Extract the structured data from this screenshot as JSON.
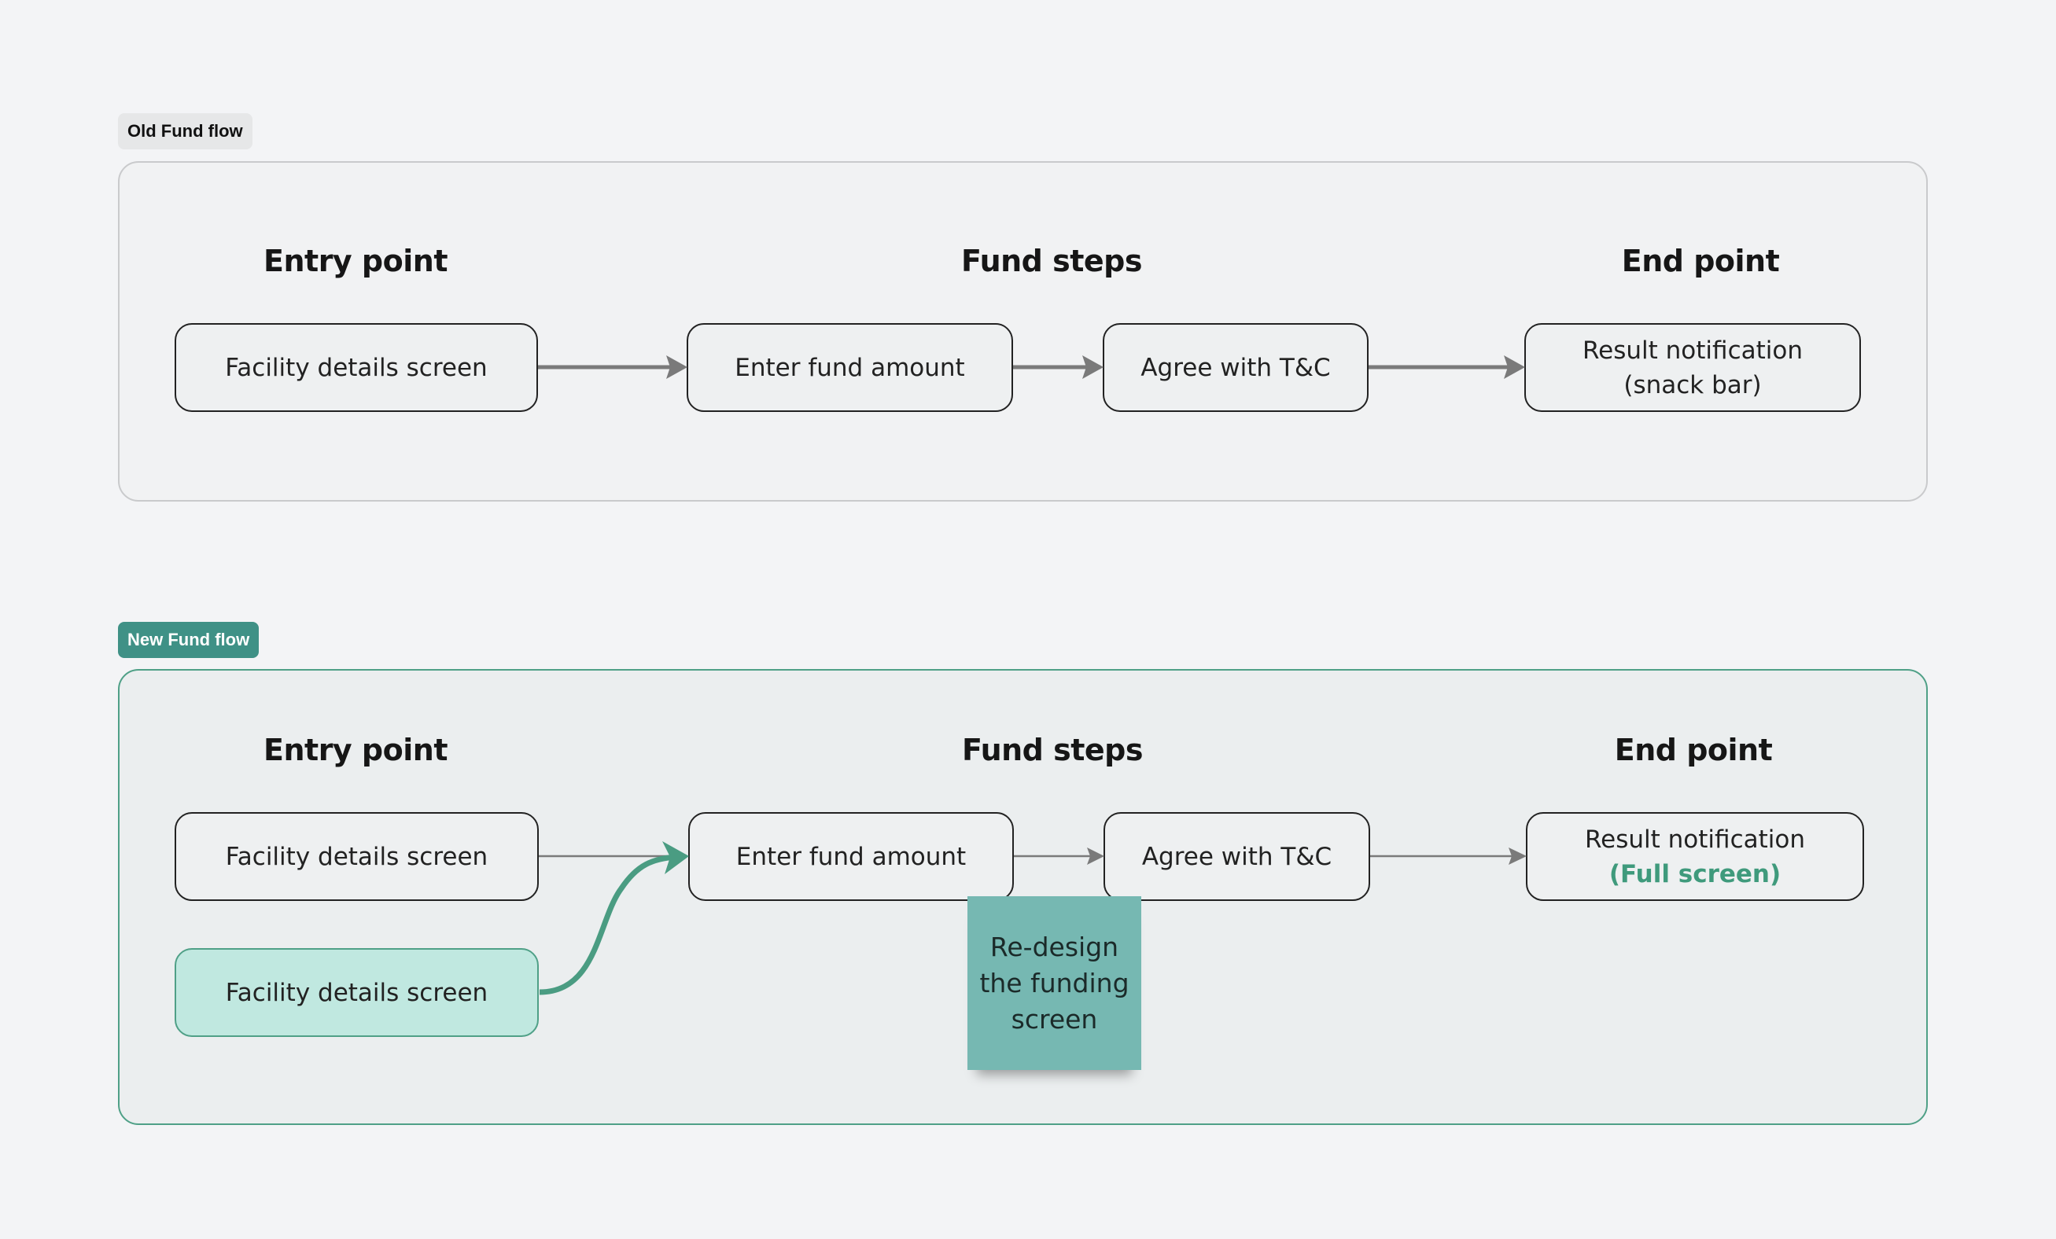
{
  "old_flow": {
    "label": "Old Fund flow",
    "headers": {
      "entry": "Entry point",
      "steps": "Fund steps",
      "end": "End point"
    },
    "nodes": {
      "facility": "Facility details screen",
      "enter_amount": "Enter fund amount",
      "agree": "Agree with T&C",
      "result_line1": "Result notification",
      "result_line2": "(snack bar)"
    }
  },
  "new_flow": {
    "label": "New Fund flow",
    "headers": {
      "entry": "Entry point",
      "steps": "Fund steps",
      "end": "End point"
    },
    "nodes": {
      "facility": "Facility details screen",
      "facility_new": "Facility details screen",
      "enter_amount": "Enter fund amount",
      "agree": "Agree with T&C",
      "result_line1": "Result notification",
      "result_line2": "(Full screen)"
    },
    "sticky_note": "Re-design the funding screen"
  },
  "colors": {
    "accent": "#3f9186",
    "highlight_fill": "#c0e8e0",
    "arrow_gray": "#7a7a7a",
    "arrow_green": "#4a9c82",
    "sticky": "#76b8b2"
  }
}
